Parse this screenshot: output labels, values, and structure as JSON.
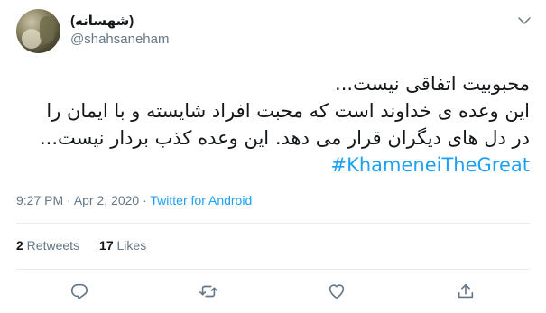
{
  "user": {
    "display_name": "(شهسانه)",
    "handle": "@shahsaneham"
  },
  "tweet": {
    "lines": [
      "محبوبیت اتفاقی نیست...",
      "این وعده ی خداوند است که محبت افراد شایسته و با ایمان را",
      "در دل های دیگران قرار می دهد. این وعده کذب بردار نیست..."
    ],
    "hashtag": "#KhameneiTheGreat"
  },
  "meta": {
    "time": "9:27 PM",
    "separator1": " · ",
    "date": "Apr 2, 2020",
    "separator2": " · ",
    "source": "Twitter for Android"
  },
  "stats": {
    "retweets_count": "2",
    "retweets_label": " Retweets",
    "likes_count": "17",
    "likes_label": " Likes"
  },
  "icons": {
    "more": "chevron-down-icon",
    "reply": "reply-icon",
    "retweet": "retweet-icon",
    "like": "heart-icon",
    "share": "share-icon"
  },
  "colors": {
    "link": "#1da1f2",
    "secondary_text": "#657786",
    "primary_text": "#14171a"
  }
}
